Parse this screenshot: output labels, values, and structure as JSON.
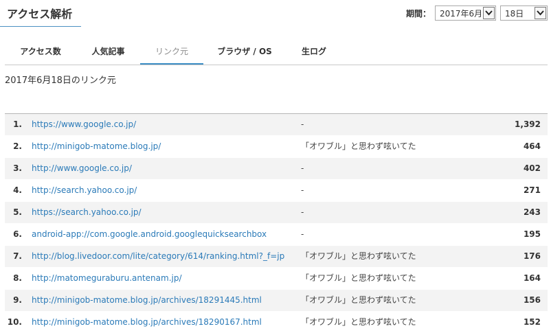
{
  "header": {
    "title": "アクセス解析"
  },
  "period": {
    "label": "期間：",
    "month_value": "2017年6月",
    "day_value": "18日"
  },
  "tabs": [
    {
      "label": "アクセス数",
      "active": false
    },
    {
      "label": "人気記事",
      "active": false
    },
    {
      "label": "リンク元",
      "active": true
    },
    {
      "label": "ブラウザ / OS",
      "active": false
    },
    {
      "label": "生ログ",
      "active": false
    }
  ],
  "subtitle": "2017年6月18日のリンク元",
  "rows": [
    {
      "rank": "1.",
      "url": "https://www.google.co.jp/",
      "title": "-",
      "count": "1,392"
    },
    {
      "rank": "2.",
      "url": "http://minigob-matome.blog.jp/",
      "title": "「オワブル」と思わず呟いてた",
      "count": "464"
    },
    {
      "rank": "3.",
      "url": "http://www.google.co.jp/",
      "title": "-",
      "count": "402"
    },
    {
      "rank": "4.",
      "url": "http://search.yahoo.co.jp/",
      "title": "-",
      "count": "271"
    },
    {
      "rank": "5.",
      "url": "https://search.yahoo.co.jp/",
      "title": "-",
      "count": "243"
    },
    {
      "rank": "6.",
      "url": "android-app://com.google.android.googlequicksearchbox",
      "title": "-",
      "count": "195"
    },
    {
      "rank": "7.",
      "url": "http://blog.livedoor.com/lite/category/614/ranking.html?_f=jp",
      "title": "「オワブル」と思わず呟いてた",
      "count": "176"
    },
    {
      "rank": "8.",
      "url": "http://matomeguraburu.antenam.jp/",
      "title": "「オワブル」と思わず呟いてた",
      "count": "164"
    },
    {
      "rank": "9.",
      "url": "http://minigob-matome.blog.jp/archives/18291445.html",
      "title": "「オワブル」と思わず呟いてた",
      "count": "156"
    },
    {
      "rank": "10.",
      "url": "http://minigob-matome.blog.jp/archives/18290167.html",
      "title": "「オワブル」と思わず呟いてた",
      "count": "152"
    }
  ],
  "colors": {
    "link": "#2a7ab8",
    "active_tab_underline": "#3d8fc6",
    "row_alt_bg": "#f3f3f3"
  }
}
